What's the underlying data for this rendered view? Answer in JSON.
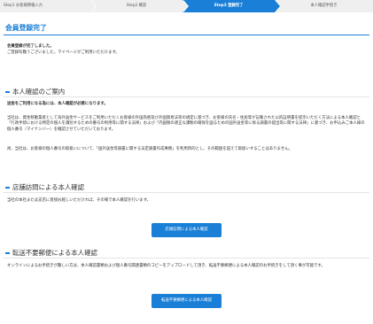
{
  "stepper": {
    "steps": [
      {
        "label": "Step1  お客様情報入力"
      },
      {
        "label": "Step2  確認"
      },
      {
        "label": "Step3  登録完了"
      },
      {
        "label": "本人確認手続き"
      }
    ],
    "active_index": 2
  },
  "page_title": "会員登録完了",
  "complete": {
    "heading": "会員登録が完了しました。",
    "text": "ご登録有難うございました。マイページがご利用いただけます。"
  },
  "identity": {
    "title": "本人確認のご案内",
    "lead": "送金をご利用になる為には、本人確認が必要になります。",
    "p1": "当社は、資金移動業者として海外送金サービスをご利用いただくお客様の外国為替及び外国貿易法等の規定に基づき、お客様の氏名・住居等が記載された公的証明書を提示いただく方法による本人確認と「行政手続における特定の個人を識別するための番号の利用等に関する法律」および「内国税の適正な課税の確保を図るための国外送金等に係る調書の提出等に関する法律」に基づき、お申込みご本人様の個人番号（マイナンバー）を確認させていただいております。",
    "p2": "尚、当社は、お客様の個人番号の取扱いについて、「国外送金等調書に関する法定調書作成事務」を利用目的とし、その範囲を超えて取扱いすることはありません。"
  },
  "store": {
    "title": "店舗訪問による本人確認",
    "text": "当社の本社または支店に直接お越しいただければ、その場で本人確認を行います。",
    "button": "店頭訪問による本人確認"
  },
  "mail": {
    "title": "転送不要郵便による本人確認",
    "text": "オンラインによるお手続きが難しい方は、本人確認書類および個人番号関連書類のコピーをアップロードして頂き、転送不要郵便による本人確認のお手続きをして頂く事が可能です。",
    "button": "転送不要郵便による本人確認"
  },
  "colors": {
    "accent": "#1a7fd6",
    "step_inactive": "#efefef"
  }
}
